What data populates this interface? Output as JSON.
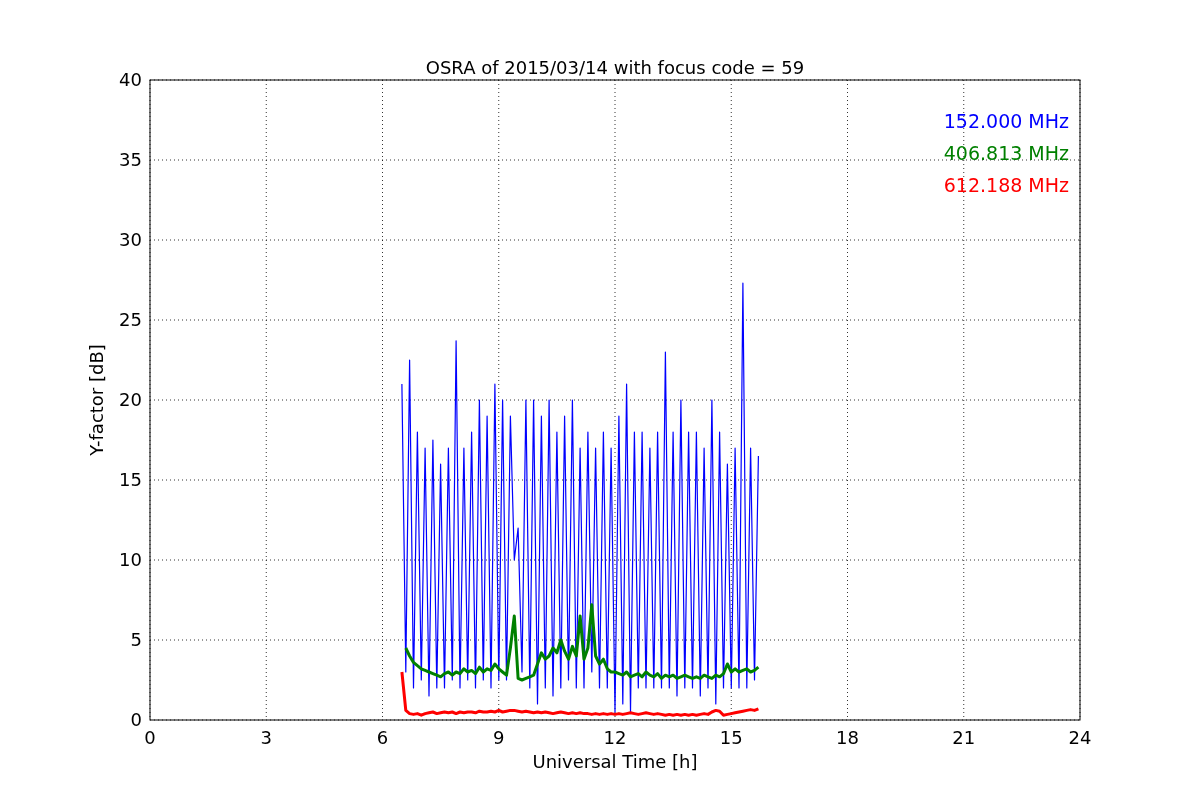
{
  "chart_data": {
    "type": "line",
    "title": "OSRA of 2015/03/14 with focus code = 59",
    "xlabel": "Universal Time [h]",
    "ylabel": "Y-factor [dB]",
    "xlim": [
      0,
      24
    ],
    "ylim": [
      0,
      40
    ],
    "grid": true,
    "xticks": [
      0,
      3,
      6,
      9,
      12,
      15,
      18,
      21,
      24
    ],
    "yticks": [
      0,
      5,
      10,
      15,
      20,
      25,
      30,
      35,
      40
    ],
    "x": [
      6.5,
      6.6,
      6.7,
      6.8,
      6.9,
      7.0,
      7.1,
      7.2,
      7.3,
      7.4,
      7.5,
      7.6,
      7.7,
      7.8,
      7.9,
      8.0,
      8.1,
      8.2,
      8.3,
      8.4,
      8.5,
      8.6,
      8.7,
      8.8,
      8.9,
      9.0,
      9.1,
      9.2,
      9.3,
      9.4,
      9.5,
      9.6,
      9.7,
      9.8,
      9.9,
      10.0,
      10.1,
      10.2,
      10.3,
      10.4,
      10.5,
      10.6,
      10.7,
      10.8,
      10.9,
      11.0,
      11.1,
      11.2,
      11.3,
      11.4,
      11.5,
      11.6,
      11.7,
      11.8,
      11.9,
      12.0,
      12.1,
      12.2,
      12.3,
      12.4,
      12.5,
      12.6,
      12.7,
      12.8,
      12.9,
      13.0,
      13.1,
      13.2,
      13.3,
      13.4,
      13.5,
      13.6,
      13.7,
      13.8,
      13.9,
      14.0,
      14.1,
      14.2,
      14.3,
      14.4,
      14.5,
      14.6,
      14.7,
      14.8,
      14.9,
      15.0,
      15.1,
      15.2,
      15.3,
      15.4,
      15.5,
      15.6,
      15.7
    ],
    "series": [
      {
        "name": "152.000 MHz",
        "color": "#0000ff",
        "values": [
          21,
          3,
          22.5,
          2,
          18,
          2.5,
          17,
          1.5,
          17.5,
          2,
          16,
          2,
          17,
          2.5,
          23.7,
          2,
          17,
          2.5,
          18,
          2,
          20,
          2.5,
          19,
          2,
          21,
          2.5,
          20,
          2.5,
          19,
          10,
          12,
          3,
          20,
          2,
          20,
          1,
          19,
          2,
          20,
          1.5,
          18,
          2,
          19,
          2.5,
          20,
          2,
          17,
          2,
          18,
          3,
          17,
          2,
          18,
          2,
          17,
          0.5,
          19,
          1,
          21,
          0.5,
          18,
          2,
          18,
          2,
          17,
          2,
          18,
          2,
          23,
          2,
          18,
          1.5,
          20,
          2,
          18,
          2,
          18,
          1.5,
          17,
          2,
          20,
          1,
          18,
          2,
          16,
          2,
          17,
          2,
          27.3,
          2,
          17,
          2.5,
          16.5
        ]
      },
      {
        "name": "406.813 MHz",
        "color": "#008000",
        "values": [
          null,
          4.5,
          4,
          3.6,
          3.4,
          3.2,
          3.1,
          3,
          2.9,
          2.8,
          2.7,
          2.9,
          3,
          2.8,
          3,
          2.9,
          3.2,
          3,
          3.1,
          2.9,
          3.3,
          3,
          3.2,
          3.1,
          3.5,
          3.2,
          3,
          2.8,
          4.5,
          6.5,
          2.6,
          2.5,
          2.6,
          2.7,
          2.8,
          3.5,
          4.2,
          3.8,
          4,
          4.5,
          4.2,
          5,
          4.3,
          3.8,
          4.6,
          4,
          6.5,
          3.8,
          4.5,
          7.2,
          4,
          3.5,
          3.8,
          3.2,
          3,
          3,
          2.9,
          2.8,
          3,
          2.7,
          2.8,
          2.9,
          2.7,
          3,
          2.8,
          2.7,
          2.9,
          2.6,
          2.8,
          2.7,
          2.8,
          2.6,
          2.7,
          2.8,
          2.7,
          2.6,
          2.7,
          2.6,
          2.8,
          2.7,
          2.6,
          2.8,
          2.7,
          2.9,
          3.5,
          3,
          3.2,
          3,
          3.1,
          3.2,
          3,
          3.1,
          3.3
        ]
      },
      {
        "name": "612.188 MHz",
        "color": "#ff0000",
        "values": [
          3,
          0.6,
          0.4,
          0.35,
          0.4,
          0.3,
          0.4,
          0.45,
          0.5,
          0.4,
          0.45,
          0.5,
          0.45,
          0.5,
          0.4,
          0.5,
          0.45,
          0.5,
          0.5,
          0.45,
          0.55,
          0.5,
          0.5,
          0.55,
          0.5,
          0.6,
          0.5,
          0.55,
          0.6,
          0.6,
          0.55,
          0.5,
          0.55,
          0.5,
          0.45,
          0.5,
          0.45,
          0.5,
          0.45,
          0.4,
          0.45,
          0.5,
          0.45,
          0.4,
          0.45,
          0.4,
          0.45,
          0.4,
          0.4,
          0.35,
          0.4,
          0.35,
          0.4,
          0.35,
          0.4,
          0.35,
          0.4,
          0.35,
          0.4,
          0.45,
          0.4,
          0.35,
          0.4,
          0.45,
          0.4,
          0.35,
          0.4,
          0.35,
          0.3,
          0.35,
          0.3,
          0.35,
          0.3,
          0.35,
          0.3,
          0.35,
          0.3,
          0.35,
          0.4,
          0.35,
          0.5,
          0.6,
          0.55,
          0.3,
          0.35,
          0.4,
          0.45,
          0.5,
          0.55,
          0.6,
          0.65,
          0.6,
          0.7
        ]
      }
    ]
  }
}
